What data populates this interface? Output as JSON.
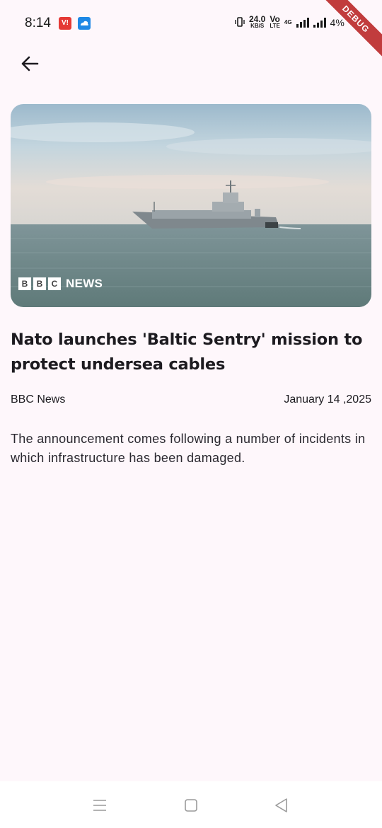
{
  "status_bar": {
    "time": "8:14",
    "app_badge_1": "V!",
    "speed_value": "24.0",
    "speed_unit": "KB/S",
    "volte_top": "Vo",
    "volte_bottom": "LTE",
    "network_type": "4G",
    "battery": "4%",
    "debug_label": "DEBUG"
  },
  "article": {
    "source_logo": {
      "letters": [
        "B",
        "B",
        "C"
      ],
      "word": "NEWS"
    },
    "title": "Nato launches 'Baltic Sentry' mission to protect undersea cables",
    "source": "BBC News",
    "date": "January 14 ,2025",
    "description": "The announcement comes following a number of incidents in which infrastructure has been damaged."
  },
  "colors": {
    "background": "#fef7fb",
    "text": "#1d1b20",
    "debug_ribbon": "#b71c1c"
  },
  "icons": {
    "back": "arrow-left-icon",
    "nav_menu": "menu-lines-icon",
    "nav_home": "square-home-icon",
    "nav_back": "triangle-back-icon"
  }
}
